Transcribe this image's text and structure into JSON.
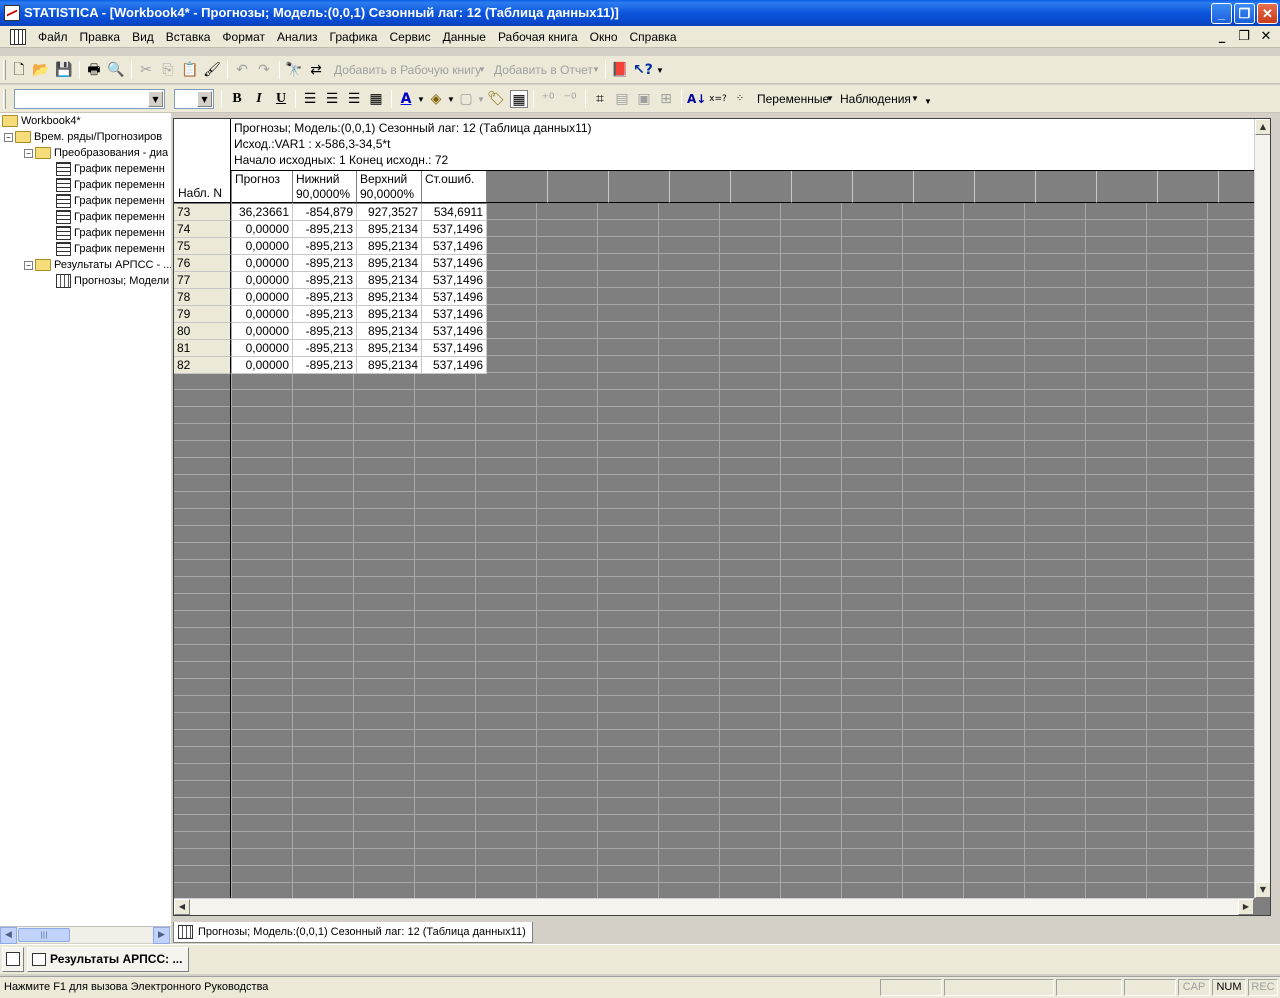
{
  "window": {
    "title": "STATISTICA - [Workbook4* - Прогнозы; Модель:(0,0,1) Сезонный лаг: 12 (Таблица данных11)]",
    "minimize_glyph": "_",
    "restore_glyph": "❐",
    "close_glyph": "✕"
  },
  "menu": {
    "items": [
      "Файл",
      "Правка",
      "Вид",
      "Вставка",
      "Формат",
      "Анализ",
      "Графика",
      "Сервис",
      "Данные",
      "Рабочая книга",
      "Окно",
      "Справка"
    ]
  },
  "toolbar1": {
    "add_to_workbook": "Добавить в Рабочую книгу",
    "add_to_report": "Добавить в Отчет"
  },
  "toolbar2": {
    "bold": "B",
    "italic": "I",
    "underline": "U",
    "variables": "Переменные",
    "observations": "Наблюдения"
  },
  "tree": {
    "root": "Workbook4*",
    "group1": "Врем. ряды/Прогнозиров",
    "sub1": "Преобразования - диа",
    "graphs": [
      "График переменн",
      "График переменн",
      "График переменн",
      "График переменн",
      "График переменн",
      "График переменн"
    ],
    "group2": "Результаты АРПСС - ...",
    "sheet": "Прогнозы; Модели"
  },
  "sheet": {
    "header_lines": [
      "Прогнозы; Модель:(0,0,1) Сезонный лаг: 12 (Таблица данных11)",
      "Исход.:VAR1 : x-586,3-34,5*t",
      "Начало исходных: 1 Конец исходн.: 72"
    ],
    "corner_label": "Набл. N",
    "columns": [
      {
        "line1": "Прогноз",
        "line2": ""
      },
      {
        "line1": "Нижний",
        "line2": "90,0000%"
      },
      {
        "line1": "Верхний",
        "line2": "90,0000%"
      },
      {
        "line1": "Ст.ошиб.",
        "line2": ""
      }
    ],
    "rows": [
      {
        "n": "73",
        "values": [
          "36,23661",
          "-854,879",
          "927,3527",
          "534,6911"
        ]
      },
      {
        "n": "74",
        "values": [
          "0,00000",
          "-895,213",
          "895,2134",
          "537,1496"
        ]
      },
      {
        "n": "75",
        "values": [
          "0,00000",
          "-895,213",
          "895,2134",
          "537,1496"
        ]
      },
      {
        "n": "76",
        "values": [
          "0,00000",
          "-895,213",
          "895,2134",
          "537,1496"
        ]
      },
      {
        "n": "77",
        "values": [
          "0,00000",
          "-895,213",
          "895,2134",
          "537,1496"
        ]
      },
      {
        "n": "78",
        "values": [
          "0,00000",
          "-895,213",
          "895,2134",
          "537,1496"
        ]
      },
      {
        "n": "79",
        "values": [
          "0,00000",
          "-895,213",
          "895,2134",
          "537,1496"
        ]
      },
      {
        "n": "80",
        "values": [
          "0,00000",
          "-895,213",
          "895,2134",
          "537,1496"
        ]
      },
      {
        "n": "81",
        "values": [
          "0,00000",
          "-895,213",
          "895,2134",
          "537,1496"
        ]
      },
      {
        "n": "82",
        "values": [
          "0,00000",
          "-895,213",
          "895,2134",
          "537,1496"
        ]
      }
    ]
  },
  "sheet_tab": "Прогнозы; Модель:(0,0,1) Сезонный лаг: 12 (Таблица данных11)",
  "window_list": {
    "item": "Результаты АРПСС: ..."
  },
  "status": {
    "message": "Нажмите F1 для вызова Электронного Руководства",
    "cap": "CAP",
    "num": "NUM",
    "rec": "REC"
  }
}
